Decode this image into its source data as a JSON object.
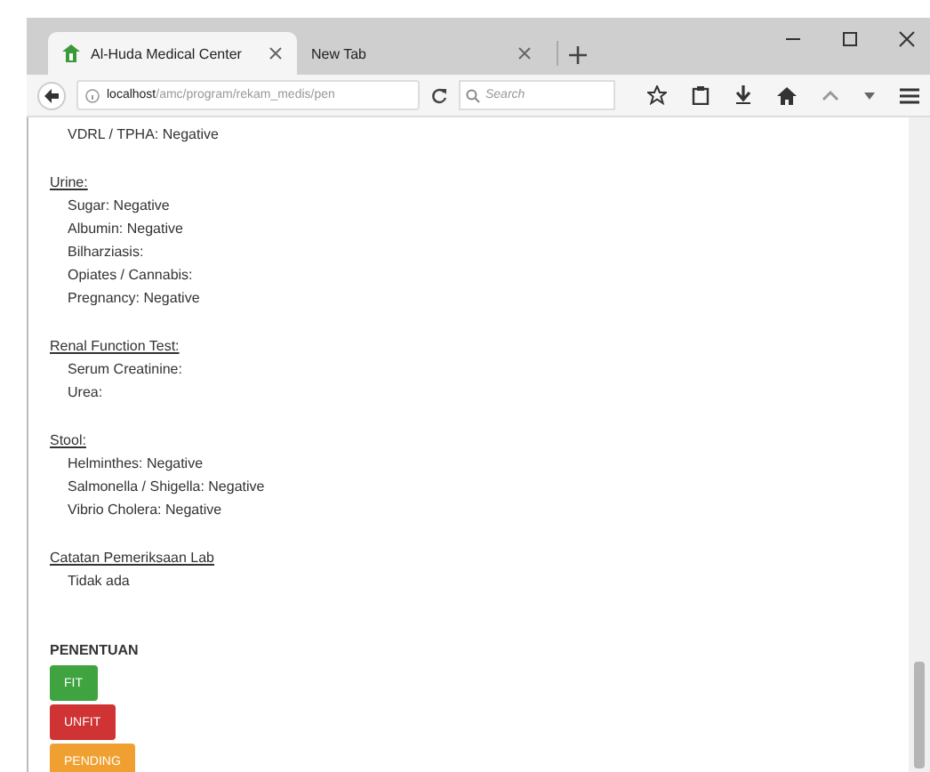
{
  "browser": {
    "tabs": [
      {
        "title": "Al-Huda Medical Center",
        "selected": true,
        "favicon": true
      },
      {
        "title": "New Tab",
        "selected": false,
        "favicon": false
      }
    ],
    "address": {
      "host": "localhost",
      "path": "/amc/program/rekam_medis/pen"
    },
    "search": {
      "placeholder": "Search"
    }
  },
  "content": {
    "top_items": [
      "VDRL / TPHA: Negative"
    ],
    "sections": [
      {
        "title": "Urine:",
        "items": [
          "Sugar: Negative",
          "Albumin: Negative",
          "Bilharziasis:",
          "Opiates / Cannabis:",
          "Pregnancy: Negative"
        ]
      },
      {
        "title": "Renal Function Test:",
        "items": [
          "Serum Creatinine:",
          "Urea:"
        ]
      },
      {
        "title": "Stool:",
        "items": [
          "Helminthes: Negative",
          "Salmonella / Shigella: Negative",
          "Vibrio Cholera: Negative"
        ]
      },
      {
        "title": "Catatan Pemeriksaan Lab",
        "items": [
          "Tidak ada"
        ]
      }
    ],
    "decision": {
      "title": "PENENTUAN",
      "buttons": [
        {
          "label": "FIT",
          "color": "#3fa33f"
        },
        {
          "label": "UNFIT",
          "color": "#cf3333"
        },
        {
          "label": "PENDING",
          "color": "#f0a030"
        }
      ]
    }
  }
}
